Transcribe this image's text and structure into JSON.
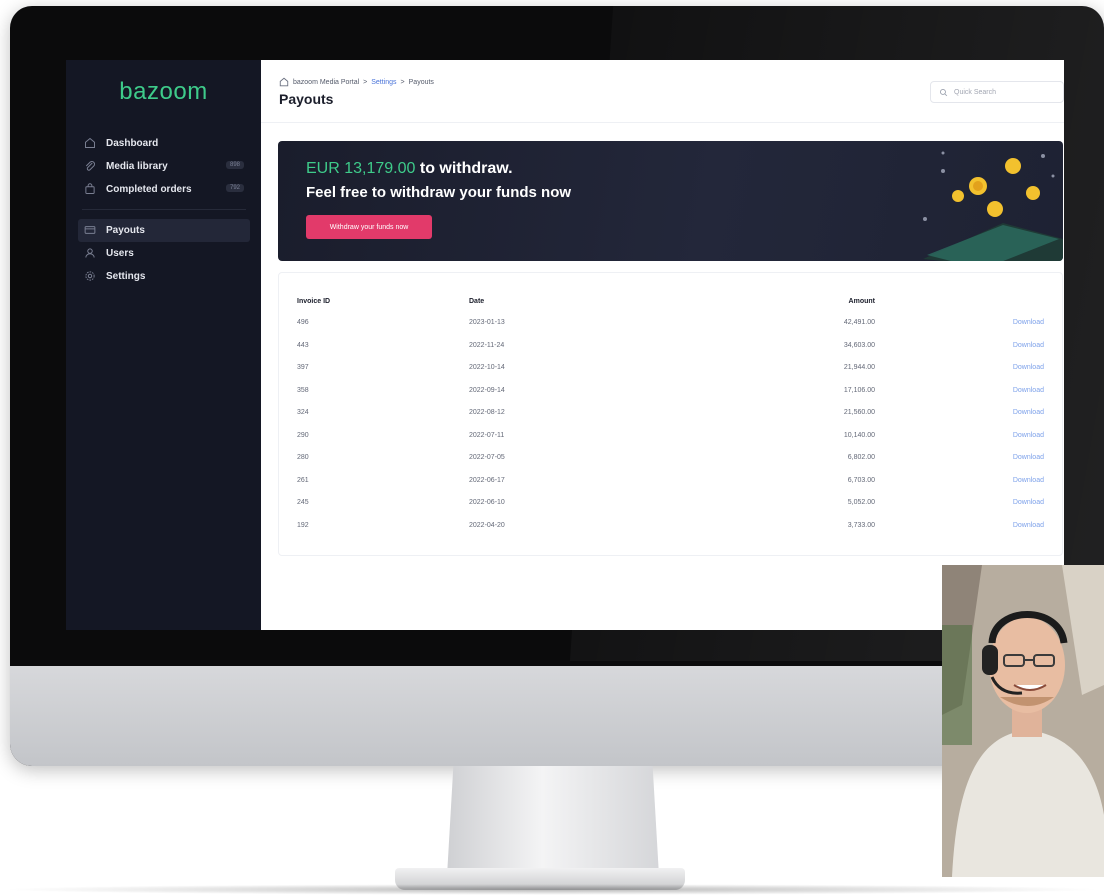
{
  "brand": {
    "logo_text": "bazoom",
    "accent": "#3ecb8a",
    "sidebar_bg": "#141724",
    "cta_color": "#e23a6a"
  },
  "sidebar": {
    "items": [
      {
        "label": "Dashboard",
        "icon": "home-icon"
      },
      {
        "label": "Media library",
        "icon": "paperclip-icon",
        "badge": "898"
      },
      {
        "label": "Completed orders",
        "icon": "bag-icon",
        "badge": "792"
      },
      {
        "label": "Payouts",
        "icon": "card-icon",
        "active": true
      },
      {
        "label": "Users",
        "icon": "user-icon"
      },
      {
        "label": "Settings",
        "icon": "gear-icon"
      }
    ]
  },
  "header": {
    "breadcrumb": [
      "bazoom Media Portal",
      ">",
      "Settings",
      ">",
      "Payouts"
    ],
    "title": "Payouts",
    "search_placeholder": "Quick Search"
  },
  "banner": {
    "amount": "EUR 13,179.00",
    "line1_suffix": "to withdraw.",
    "line2": "Feel free to withdraw your funds now",
    "button_label": "Withdraw your funds now"
  },
  "table": {
    "columns": [
      "Invoice ID",
      "Date",
      "Amount"
    ],
    "rows": [
      {
        "id": "496",
        "date": "2023-01-13",
        "amount": "42,491.00",
        "action": "Download"
      },
      {
        "id": "443",
        "date": "2022-11-24",
        "amount": "34,603.00",
        "action": "Download"
      },
      {
        "id": "397",
        "date": "2022-10-14",
        "amount": "21,944.00",
        "action": "Download"
      },
      {
        "id": "358",
        "date": "2022-09-14",
        "amount": "17,106.00",
        "action": "Download"
      },
      {
        "id": "324",
        "date": "2022-08-12",
        "amount": "21,560.00",
        "action": "Download"
      },
      {
        "id": "290",
        "date": "2022-07-11",
        "amount": "10,140.00",
        "action": "Download"
      },
      {
        "id": "280",
        "date": "2022-07-05",
        "amount": "6,802.00",
        "action": "Download"
      },
      {
        "id": "261",
        "date": "2022-06-17",
        "amount": "6,703.00",
        "action": "Download"
      },
      {
        "id": "245",
        "date": "2022-06-10",
        "amount": "5,052.00",
        "action": "Download"
      },
      {
        "id": "192",
        "date": "2022-04-20",
        "amount": "3,733.00",
        "action": "Download"
      }
    ]
  }
}
